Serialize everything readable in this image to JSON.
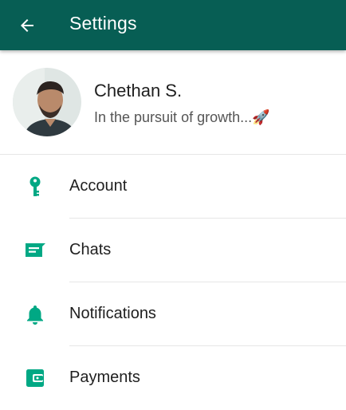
{
  "app_bar": {
    "title": "Settings",
    "back_icon": "arrow-left-icon",
    "background": "#075E54"
  },
  "profile": {
    "name": "Chethan S.",
    "status": "In the pursuit of growth...🚀",
    "avatar_icon": "profile-photo"
  },
  "menu": {
    "items": [
      {
        "label": "Account",
        "icon": "key-icon"
      },
      {
        "label": "Chats",
        "icon": "chat-icon"
      },
      {
        "label": "Notifications",
        "icon": "bell-icon"
      },
      {
        "label": "Payments",
        "icon": "wallet-icon"
      }
    ],
    "icon_color": "#00A884"
  }
}
